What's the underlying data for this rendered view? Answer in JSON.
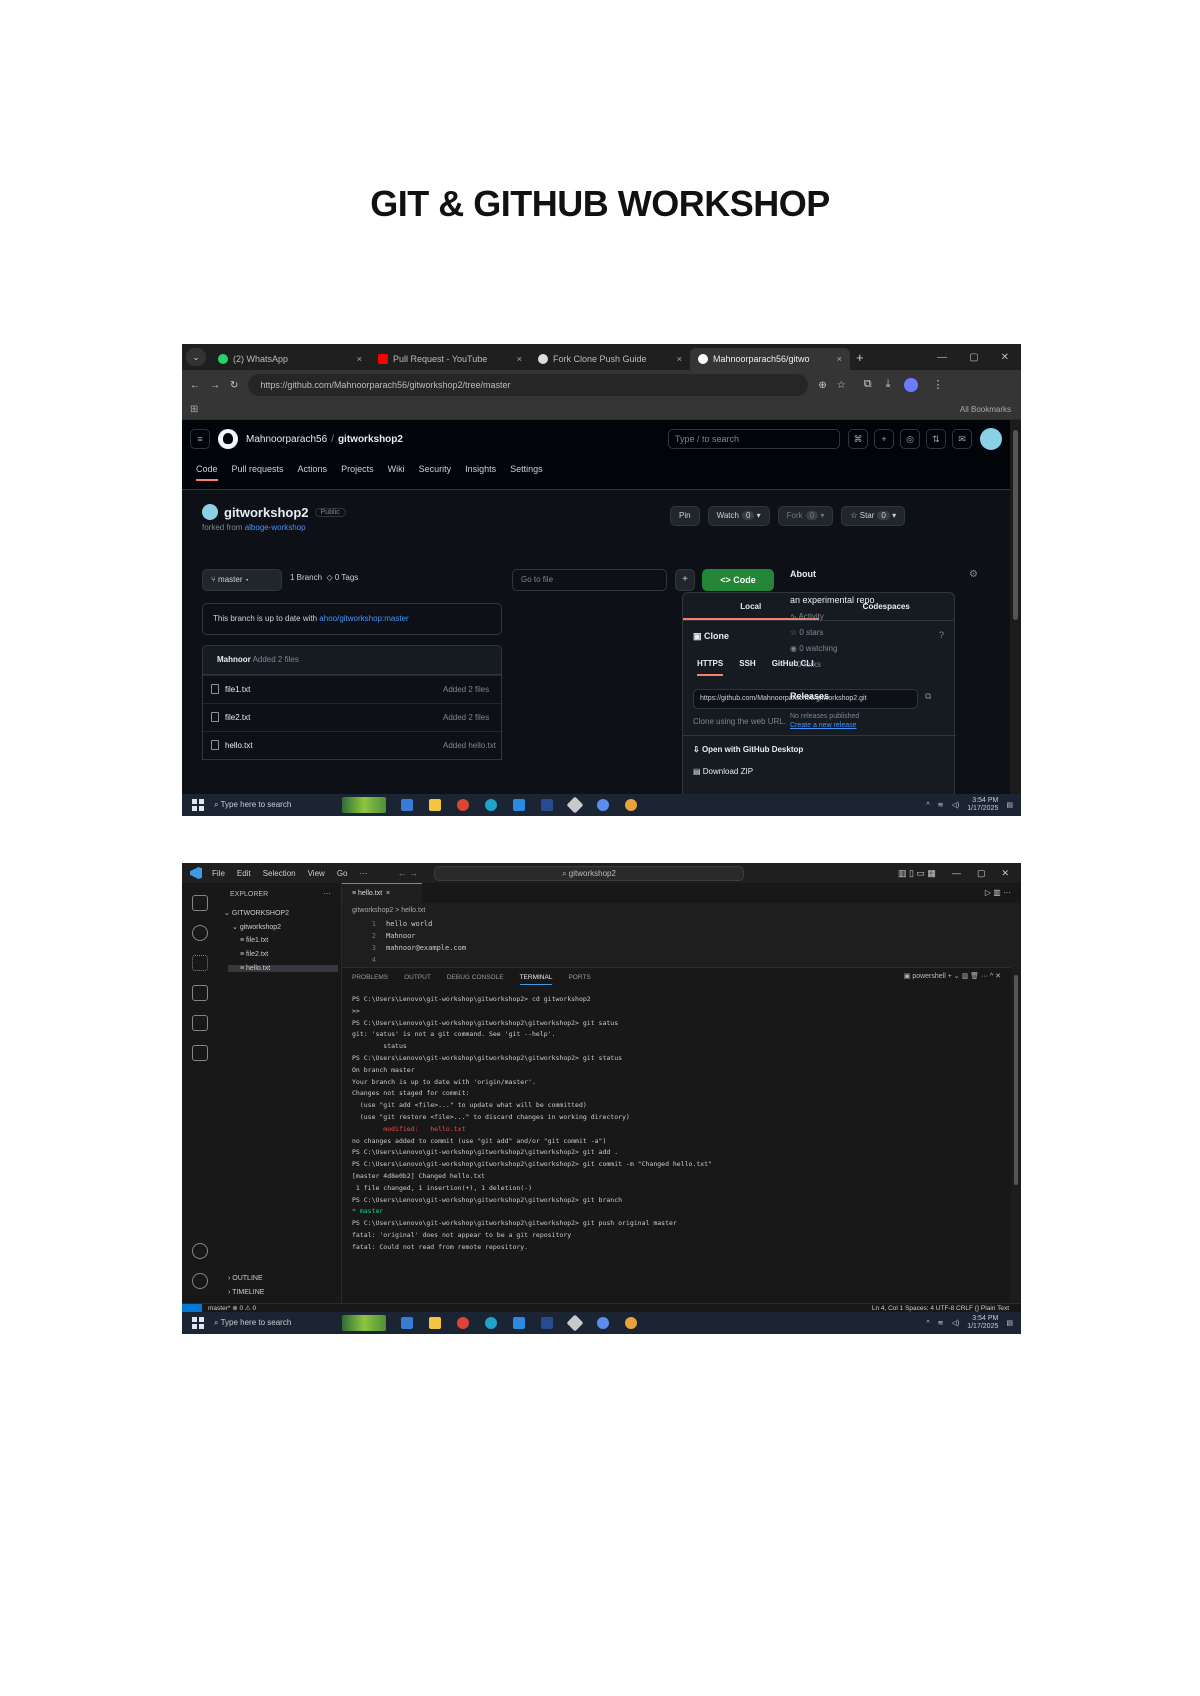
{
  "document": {
    "title": "GIT & GITHUB WORKSHOP"
  },
  "browser": {
    "tabs": [
      {
        "label": "(2) WhatsApp",
        "color": "#25d366"
      },
      {
        "label": "Pull Request - YouTube",
        "color": "#ff0000"
      },
      {
        "label": "Fork Clone Push Guide",
        "color": "#dddddd"
      },
      {
        "label": "Mahnoorparach56/gitwo",
        "color": "#ffffff"
      }
    ],
    "url": "https://github.com/Mahnoorparach56/gitworkshop2/tree/master",
    "all_bookmarks": "All Bookmarks"
  },
  "github": {
    "owner": "Mahnoorparach56",
    "repo": "gitworkshop2",
    "search_placeholder": "Type / to search",
    "nav": [
      "Code",
      "Pull requests",
      "Actions",
      "Projects",
      "Wiki",
      "Security",
      "Insights",
      "Settings"
    ],
    "visibility": "Public",
    "forked_prefix": "forked from",
    "forked_link": "alboge-workshop",
    "actions": {
      "pin": "Pin",
      "watch": "Watch",
      "watch_count": "0",
      "fork": "Fork",
      "fork_count": "0",
      "star": "Star",
      "star_count": "0"
    },
    "branch": "master",
    "branches": "1 Branch",
    "tags": "0 Tags",
    "goto_placeholder": "Go to file",
    "code_button": "<> Code",
    "uptodate_text": "This branch is up to date with",
    "uptodate_link": "ahoo/gitworkshop:master",
    "commit_author": "Mahnoor",
    "commit_msg": "Added 2 files",
    "files": [
      {
        "name": "file1.txt",
        "msg": "Added 2 files"
      },
      {
        "name": "file2.txt",
        "msg": "Added 2 files"
      },
      {
        "name": "hello.txt",
        "msg": "Added hello.txt"
      }
    ],
    "clone": {
      "tab_local": "Local",
      "tab_codespaces": "Codespaces",
      "title": "Clone",
      "protocols": [
        "HTTPS",
        "SSH",
        "GitHub CLI"
      ],
      "url": "https://github.com/Mahnoorparach56/gitworkshop2.git",
      "hint": "Clone using the web URL.",
      "desktop": "Open with GitHub Desktop",
      "zip": "Download ZIP"
    },
    "about": {
      "title": "About",
      "description": "an experimental repo",
      "stats": [
        "Activity",
        "0 stars",
        "0 watching",
        "0 forks"
      ],
      "releases_title": "Releases",
      "releases_text": "No releases published",
      "releases_link": "Create a new release"
    }
  },
  "taskbar": {
    "search": "Type here to search",
    "time": "3:54 PM",
    "date": "1/17/2025"
  },
  "vscode": {
    "menu": [
      "File",
      "Edit",
      "Selection",
      "View",
      "Go",
      "···"
    ],
    "command_center": "gitworkshop2",
    "explorer_title": "EXPLORER",
    "workspace": "GITWORKSHOP2",
    "folder": "gitworkshop2",
    "files": [
      "file1.txt",
      "file2.txt",
      "hello.txt"
    ],
    "outline": "OUTLINE",
    "timeline": "TIMELINE",
    "editor_tab": "hello.txt",
    "breadcrumb": "gitworkshop2 > hello.txt",
    "code_lines": [
      "hello world",
      "Mahnoor",
      "mahnoor@example.com",
      ""
    ],
    "panel_tabs": [
      "PROBLEMS",
      "OUTPUT",
      "DEBUG CONSOLE",
      "TERMINAL",
      "PORTS"
    ],
    "terminal_label": "powershell",
    "terminal": [
      {
        "t": "PS C:\\Users\\Lenovo\\git-workshop\\gitworkshop2> cd gitworkshop2",
        "c": ""
      },
      {
        "t": ">>",
        "c": ""
      },
      {
        "t": "PS C:\\Users\\Lenovo\\git-workshop\\gitworkshop2\\gitworkshop2> git satus",
        "c": ""
      },
      {
        "t": "git: 'satus' is not a git command. See 'git --help'.",
        "c": ""
      },
      {
        "t": "",
        "c": ""
      },
      {
        "t": "        status",
        "c": ""
      },
      {
        "t": "PS C:\\Users\\Lenovo\\git-workshop\\gitworkshop2\\gitworkshop2> git status",
        "c": ""
      },
      {
        "t": "On branch master",
        "c": ""
      },
      {
        "t": "Your branch is up to date with 'origin/master'.",
        "c": ""
      },
      {
        "t": "",
        "c": ""
      },
      {
        "t": "Changes not staged for commit:",
        "c": ""
      },
      {
        "t": "  (use \"git add <file>...\" to update what will be committed)",
        "c": ""
      },
      {
        "t": "  (use \"git restore <file>...\" to discard changes in working directory)",
        "c": ""
      },
      {
        "t": "        modified:   hello.txt",
        "c": "t-red"
      },
      {
        "t": "",
        "c": ""
      },
      {
        "t": "no changes added to commit (use \"git add\" and/or \"git commit -a\")",
        "c": ""
      },
      {
        "t": "PS C:\\Users\\Lenovo\\git-workshop\\gitworkshop2\\gitworkshop2> git add .",
        "c": ""
      },
      {
        "t": "PS C:\\Users\\Lenovo\\git-workshop\\gitworkshop2\\gitworkshop2> git commit -m \"Changed hello.txt\"",
        "c": ""
      },
      {
        "t": "[master 4d8e0b2] Changed hello.txt",
        "c": ""
      },
      {
        "t": " 1 file changed, 1 insertion(+), 1 deletion(-)",
        "c": ""
      },
      {
        "t": "PS C:\\Users\\Lenovo\\git-workshop\\gitworkshop2\\gitworkshop2> git branch",
        "c": ""
      },
      {
        "t": "* master",
        "c": "t-grn"
      },
      {
        "t": "PS C:\\Users\\Lenovo\\git-workshop\\gitworkshop2\\gitworkshop2> git push original master",
        "c": ""
      },
      {
        "t": "fatal: 'original' does not appear to be a git repository",
        "c": ""
      },
      {
        "t": "fatal: Could not read from remote repository.",
        "c": ""
      }
    ],
    "status_left": "master*  ⊗ 0 ⚠ 0",
    "status_right": "Ln 4, Col 1   Spaces: 4   UTF-8   CRLF   {} Plain Text"
  }
}
